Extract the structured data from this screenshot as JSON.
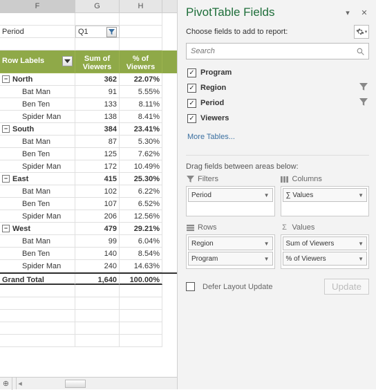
{
  "columns": {
    "F": "F",
    "G": "G",
    "H": "H"
  },
  "filterRow": {
    "label": "Period",
    "value": "Q1"
  },
  "headers": {
    "rowLabels": "Row Labels",
    "sum": "Sum of Viewers",
    "pct": "% of Viewers"
  },
  "regions": [
    {
      "name": "North",
      "sum": 362,
      "pct": "22.07%",
      "items": [
        {
          "name": "Bat Man",
          "sum": 91,
          "pct": "5.55%"
        },
        {
          "name": "Ben Ten",
          "sum": 133,
          "pct": "8.11%"
        },
        {
          "name": "Spider Man",
          "sum": 138,
          "pct": "8.41%"
        }
      ]
    },
    {
      "name": "South",
      "sum": 384,
      "pct": "23.41%",
      "items": [
        {
          "name": "Bat Man",
          "sum": 87,
          "pct": "5.30%"
        },
        {
          "name": "Ben Ten",
          "sum": 125,
          "pct": "7.62%"
        },
        {
          "name": "Spider Man",
          "sum": 172,
          "pct": "10.49%"
        }
      ]
    },
    {
      "name": "East",
      "sum": 415,
      "pct": "25.30%",
      "items": [
        {
          "name": "Bat Man",
          "sum": 102,
          "pct": "6.22%"
        },
        {
          "name": "Ben Ten",
          "sum": 107,
          "pct": "6.52%"
        },
        {
          "name": "Spider Man",
          "sum": 206,
          "pct": "12.56%"
        }
      ]
    },
    {
      "name": "West",
      "sum": 479,
      "pct": "29.21%",
      "items": [
        {
          "name": "Bat Man",
          "sum": 99,
          "pct": "6.04%"
        },
        {
          "name": "Ben Ten",
          "sum": 140,
          "pct": "8.54%"
        },
        {
          "name": "Spider Man",
          "sum": 240,
          "pct": "14.63%"
        }
      ]
    }
  ],
  "grand": {
    "label": "Grand Total",
    "sum": "1,640",
    "pct": "100.00%"
  },
  "panel": {
    "title": "PivotTable Fields",
    "subtitle": "Choose fields to add to report:",
    "searchPlaceholder": "Search",
    "fields": [
      {
        "name": "Program",
        "checked": true,
        "filter": false
      },
      {
        "name": "Region",
        "checked": true,
        "filter": true
      },
      {
        "name": "Period",
        "checked": true,
        "filter": true
      },
      {
        "name": "Viewers",
        "checked": true,
        "filter": false
      }
    ],
    "moreTables": "More Tables...",
    "dragText": "Drag fields between areas below:",
    "areas": {
      "filters": {
        "label": "Filters",
        "items": [
          "Period"
        ]
      },
      "columns": {
        "label": "Columns",
        "items": [
          "∑ Values"
        ]
      },
      "rows": {
        "label": "Rows",
        "items": [
          "Region",
          "Program"
        ]
      },
      "values": {
        "label": "Values",
        "items": [
          "Sum of Viewers",
          "% of Viewers"
        ]
      }
    },
    "defer": "Defer Layout Update",
    "update": "Update"
  },
  "chart_data": {
    "type": "table",
    "filter": {
      "Period": "Q1"
    },
    "columns": [
      "Region",
      "Program",
      "Sum of Viewers",
      "% of Viewers"
    ],
    "rows": [
      [
        "North",
        "Bat Man",
        91,
        5.55
      ],
      [
        "North",
        "Ben Ten",
        133,
        8.11
      ],
      [
        "North",
        "Spider Man",
        138,
        8.41
      ],
      [
        "South",
        "Bat Man",
        87,
        5.3
      ],
      [
        "South",
        "Ben Ten",
        125,
        7.62
      ],
      [
        "South",
        "Spider Man",
        172,
        10.49
      ],
      [
        "East",
        "Bat Man",
        102,
        6.22
      ],
      [
        "East",
        "Ben Ten",
        107,
        6.52
      ],
      [
        "East",
        "Spider Man",
        206,
        12.56
      ],
      [
        "West",
        "Bat Man",
        99,
        6.04
      ],
      [
        "West",
        "Ben Ten",
        140,
        8.54
      ],
      [
        "West",
        "Spider Man",
        240,
        14.63
      ]
    ],
    "subtotals": [
      [
        "North",
        362,
        22.07
      ],
      [
        "South",
        384,
        23.41
      ],
      [
        "East",
        415,
        25.3
      ],
      [
        "West",
        479,
        29.21
      ]
    ],
    "grand_total": [
      1640,
      100.0
    ]
  }
}
